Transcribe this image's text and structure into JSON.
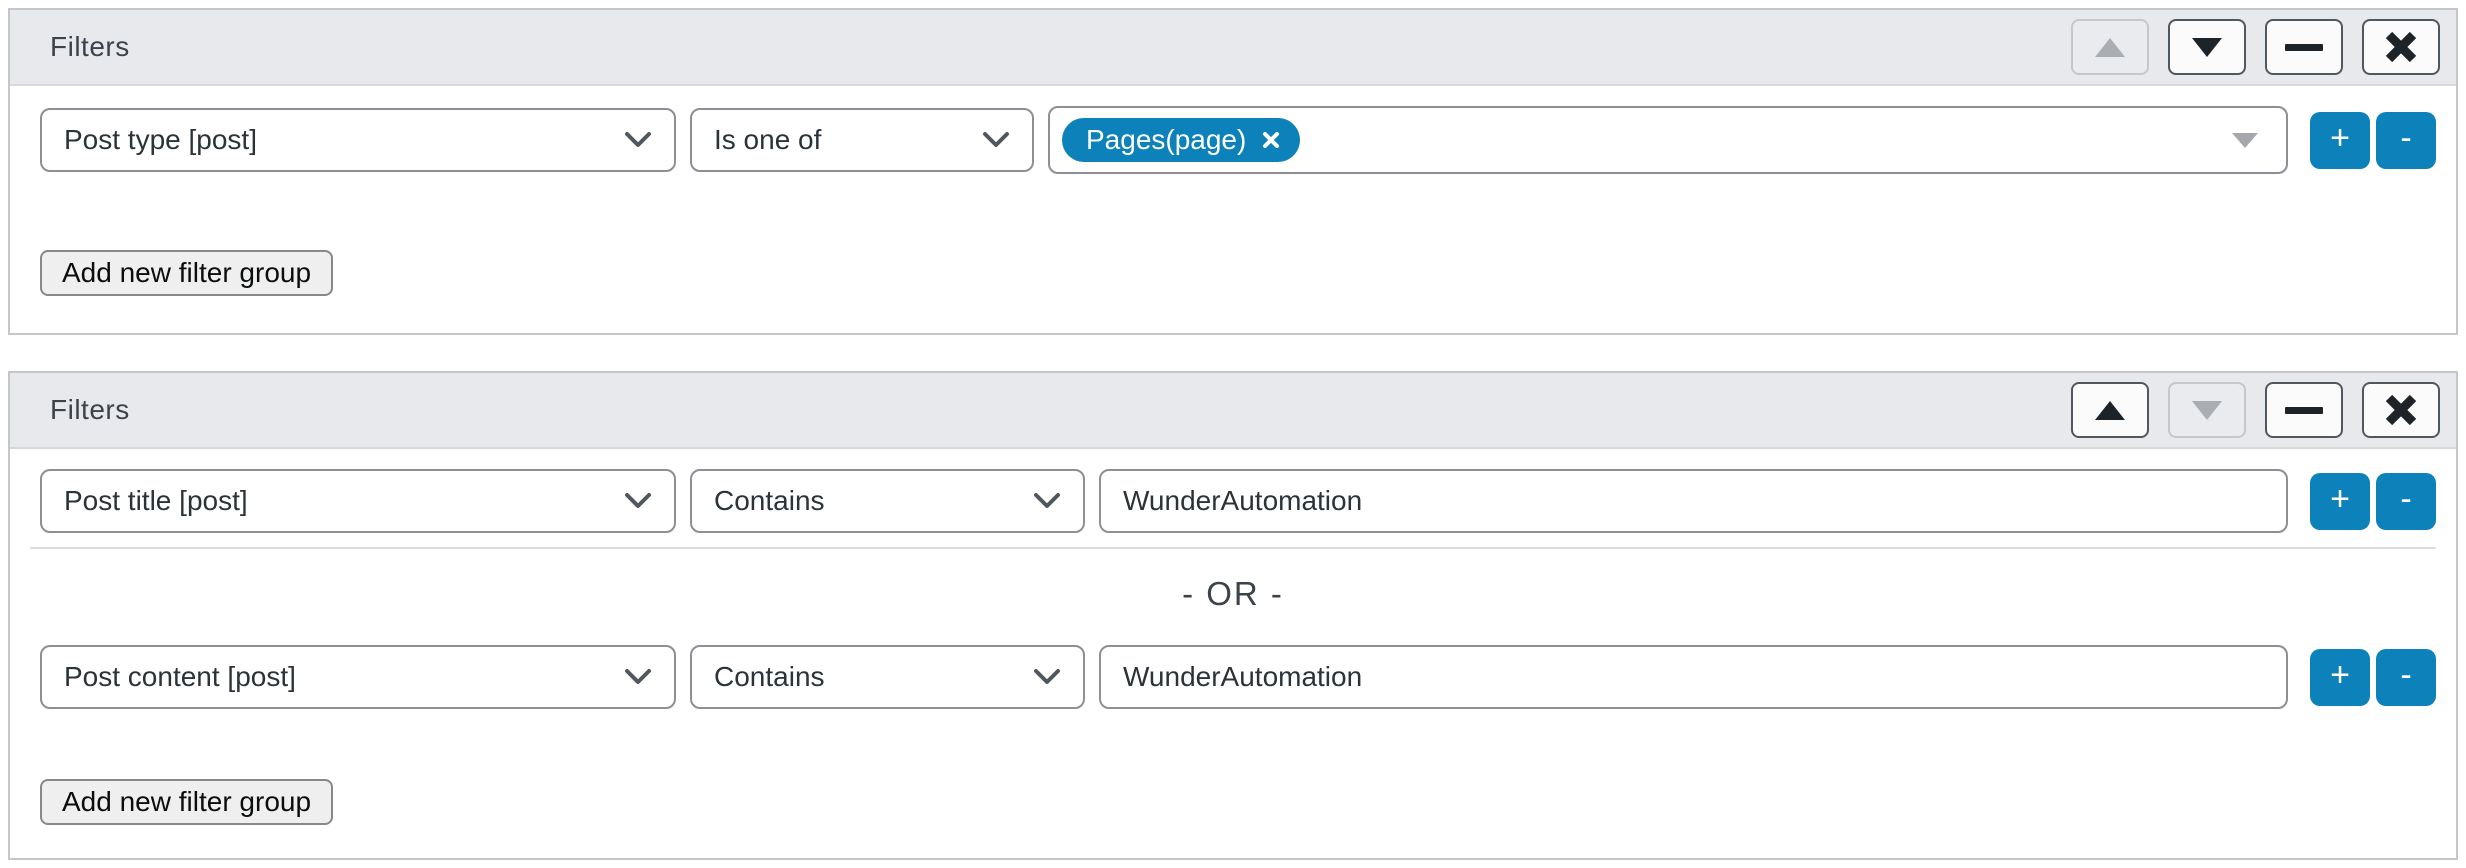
{
  "panel1": {
    "title": "Filters",
    "rule": {
      "field": "Post type [post]",
      "operator": "Is one of",
      "tag": "Pages(page)"
    },
    "add_group_label": "Add new filter group"
  },
  "panel2": {
    "title": "Filters",
    "rule1": {
      "field": "Post title [post]",
      "operator": "Contains",
      "value": "WunderAutomation"
    },
    "or_label": "- OR -",
    "rule2": {
      "field": "Post content [post]",
      "operator": "Contains",
      "value": "WunderAutomation"
    },
    "add_group_label": "Add new filter group"
  },
  "buttons": {
    "add_rule": "+",
    "remove_rule": "-"
  },
  "icons": {
    "move_up": "up-triangle-icon",
    "move_down": "down-triangle-icon",
    "collapse": "minus-icon",
    "close": "x-icon",
    "select_caret": "chevron-down-icon",
    "multiselect_caret": "down-triangle-icon",
    "tag_remove": "x-icon"
  },
  "colors": {
    "accent_blue": "#0d82ba",
    "header_bg": "#e8e9ed",
    "panel_border": "#c5c6ca",
    "control_border": "#8c8f94",
    "text_dark": "#2c3338"
  }
}
